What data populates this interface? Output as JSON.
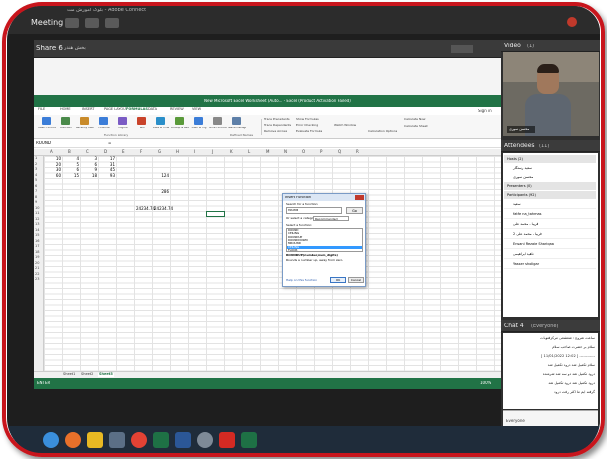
{
  "meeting": {
    "window_title": "بلوک امورش مت - Adobe Connect",
    "menu_label": "Meeting",
    "share_title": "Share 6",
    "share_subtitle": "بخش هندر",
    "video_title": "Video",
    "video_count": "(1)",
    "presenter_caption": "محسن سوری"
  },
  "excel": {
    "title": "New Microsoft Excel Worksheet (Auto... - Excel (Product Activation Failed)",
    "account": "Sign in",
    "tabs": [
      "FILE",
      "HOME",
      "INSERT",
      "PAGE LAYOUT",
      "FORMULAS",
      "DATA",
      "REVIEW",
      "VIEW"
    ],
    "ribbon_buttons": [
      "Insert Function",
      "AutoSum",
      "Recently Used",
      "Financial",
      "Logical",
      "Text",
      "Date & Time",
      "Lookup & Reference",
      "Math & Trig",
      "More Functions",
      "Name Manager"
    ],
    "ribbon_group": "Function Library",
    "ribbon_defined": "Defined Names",
    "ribbon_audit": [
      "Trace Precedents",
      "Trace Dependents",
      "Remove Arrows",
      "Show Formulas",
      "Error Checking",
      "Evaluate Formula"
    ],
    "ribbon_watch": "Watch Window",
    "ribbon_calc": [
      "Calculation Options",
      "Calculate Now",
      "Calculate Sheet"
    ],
    "name_box": "ROUND",
    "formula": "=",
    "columns": [
      "A",
      "B",
      "C",
      "D",
      "E",
      "F",
      "G",
      "H",
      "I",
      "J",
      "K",
      "L",
      "M",
      "N",
      "O",
      "P",
      "Q",
      "R"
    ],
    "rows": [
      "1",
      "2",
      "3",
      "4",
      "5",
      "6",
      "7",
      "8",
      "9",
      "10",
      "11",
      "12",
      "13",
      "14",
      "15",
      "16",
      "17",
      "18",
      "19",
      "20",
      "21",
      "22",
      "23"
    ],
    "cells": [
      {
        "r": 1,
        "c": 0,
        "v": "10"
      },
      {
        "r": 1,
        "c": 1,
        "v": "4"
      },
      {
        "r": 1,
        "c": 2,
        "v": "3"
      },
      {
        "r": 1,
        "c": 3,
        "v": "17"
      },
      {
        "r": 2,
        "c": 0,
        "v": "20"
      },
      {
        "r": 2,
        "c": 1,
        "v": "5"
      },
      {
        "r": 2,
        "c": 2,
        "v": "6"
      },
      {
        "r": 2,
        "c": 3,
        "v": "31"
      },
      {
        "r": 3,
        "c": 0,
        "v": "30"
      },
      {
        "r": 3,
        "c": 1,
        "v": "6"
      },
      {
        "r": 3,
        "c": 2,
        "v": "9"
      },
      {
        "r": 3,
        "c": 3,
        "v": "45"
      },
      {
        "r": 4,
        "c": 0,
        "v": "60"
      },
      {
        "r": 4,
        "c": 1,
        "v": "15"
      },
      {
        "r": 4,
        "c": 2,
        "v": "18"
      },
      {
        "r": 4,
        "c": 3,
        "v": "93"
      },
      {
        "r": 4,
        "c": 6,
        "v": "124"
      },
      {
        "r": 7,
        "c": 6,
        "v": "286"
      },
      {
        "r": 10,
        "c": 5,
        "v": "24234.74"
      },
      {
        "r": 10,
        "c": 6,
        "v": "24234.74"
      }
    ],
    "sheets": [
      "Sheet1",
      "Sheet2",
      "Sheet3"
    ],
    "active_sheet": "Sheet3",
    "status_left": "ENTER",
    "zoom": "100%"
  },
  "dialog": {
    "title": "Insert Function",
    "search_label": "Search for a function:",
    "search_value": "round",
    "go_label": "Go",
    "category_label": "Or select a category:",
    "category_value": "Recommended",
    "select_label": "Select a function:",
    "functions": [
      "ROUND",
      "CEILING",
      "ROUNDUP",
      "ROUNDDOWN",
      "MROUND",
      "CEILING",
      "FLOOR"
    ],
    "selected_function": "CEILING",
    "signature": "ROUNDUP(number,num_digits)",
    "description": "Rounds a number up, away from zero.",
    "help_link": "Help on this function",
    "ok_label": "OK",
    "cancel_label": "Cancel"
  },
  "attendees": {
    "title": "Attendees",
    "count": "(11)",
    "hosts_label": "Hosts (2)",
    "hosts": [
      "سعید رستگار",
      "محسن سوری"
    ],
    "presenters_label": "Presenters (0)",
    "participants_label": "Participants (92)",
    "participants": [
      "سعید",
      "fatfe na_tahmas",
      "فریبا ، محمد علی",
      "فریبا ، محمد علی 2",
      "Ensani Rezaie Shariqaa",
      "ناهید ابراهیمی",
      "Yasser sholigar"
    ]
  },
  "chat": {
    "title": "Chat 4",
    "subtitle": "(Everyone)",
    "messages": [
      "ساعت شروع : شعشعی مرکزفتوبات",
      "سلام بر حضرت صاحب سلام",
      "[ 11/01/2022 12:02 ] ------------",
      "سلام تکمیل شد درود تکمیل شد",
      "درود تکمیل شد دو سه شد شرمنده",
      "درود تکمیل شد درود تکمیل شد",
      "گرفته ایم ما اکثر رفت درود"
    ],
    "recipient": "Everyone"
  }
}
